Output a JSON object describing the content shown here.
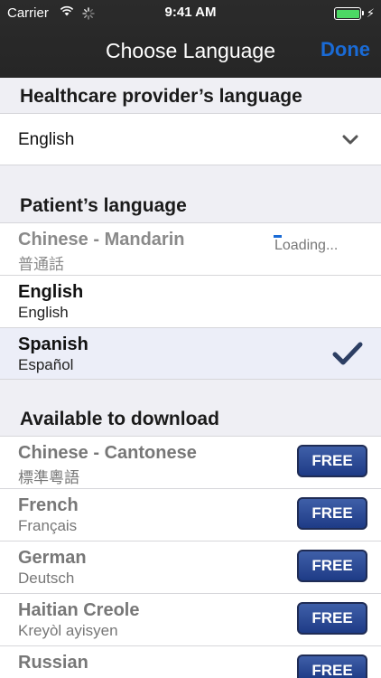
{
  "status": {
    "carrier": "Carrier",
    "time": "9:41 AM"
  },
  "nav": {
    "title": "Choose Language",
    "done": "Done"
  },
  "provider": {
    "header": "Healthcare provider’s language",
    "value": "English"
  },
  "patient": {
    "header": "Patient’s language",
    "items": [
      {
        "primary": "Chinese - Mandarin",
        "secondary": "普通話",
        "status": "Loading..."
      },
      {
        "primary": "English",
        "secondary": "English"
      },
      {
        "primary": "Spanish",
        "secondary": "Español",
        "selected": true
      }
    ]
  },
  "download": {
    "header": "Available to download",
    "button_label": "FREE",
    "items": [
      {
        "primary": "Chinese - Cantonese",
        "secondary": "標準粵語"
      },
      {
        "primary": "French",
        "secondary": "Français"
      },
      {
        "primary": "German",
        "secondary": "Deutsch"
      },
      {
        "primary": "Haitian Creole",
        "secondary": "Kreyòl ayisyen"
      },
      {
        "primary": "Russian",
        "secondary": ""
      }
    ]
  },
  "colors": {
    "accent": "#1a6bd6",
    "battery": "#4cd964",
    "free_button": "#2c4a98",
    "checkmark": "#2c3e63"
  }
}
